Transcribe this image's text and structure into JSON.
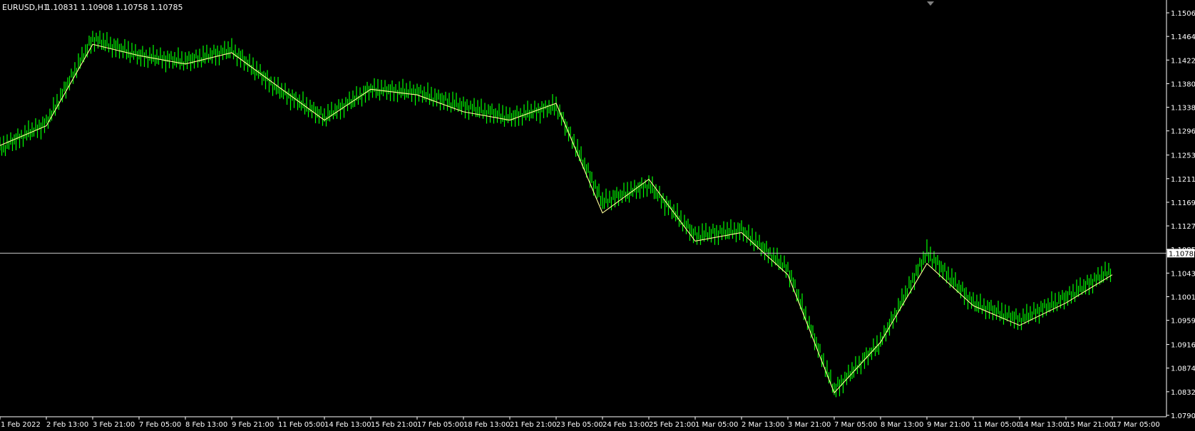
{
  "header": {
    "symbol": "EURUSD,H1",
    "ohlc": "1.10831 1.10908 1.10758 1.10785"
  },
  "chart_data": {
    "type": "line",
    "title": "EURUSD,H1  1.10831 1.10908 1.10758 1.10785",
    "xlabel": "",
    "ylabel": "",
    "ylim": [
      1.079,
      1.1506
    ],
    "grid": false,
    "legend": "none",
    "colors": {
      "background": "#000000",
      "bars": "#00ff00",
      "ma_line": "#ffff99",
      "price_line": "#c0c0c0",
      "axis": "#ffffff"
    },
    "y_ticks": [
      "1.15060",
      "1.14640",
      "1.14220",
      "1.13800",
      "1.13380",
      "1.12960",
      "1.12530",
      "1.12110",
      "1.11690",
      "1.11270",
      "1.10850",
      "1.10430",
      "1.10010",
      "1.09590",
      "1.09160",
      "1.08740",
      "1.08320",
      "1.07900"
    ],
    "x_ticks": [
      "1 Feb 2022",
      "2 Feb 13:00",
      "3 Feb 21:00",
      "7 Feb 05:00",
      "8 Feb 13:00",
      "9 Feb 21:00",
      "11 Feb 05:00",
      "14 Feb 13:00",
      "15 Feb 21:00",
      "17 Feb 05:00",
      "18 Feb 13:00",
      "21 Feb 21:00",
      "23 Feb 05:00",
      "24 Feb 13:00",
      "25 Feb 21:00",
      "1 Mar 05:00",
      "2 Mar 13:00",
      "3 Mar 21:00",
      "7 Mar 05:00",
      "8 Mar 13:00",
      "9 Mar 21:00",
      "11 Mar 05:00",
      "14 Mar 13:00",
      "15 Mar 21:00",
      "17 Mar 05:00"
    ],
    "current_price": "1.10785",
    "series": [
      {
        "name": "",
        "type": "bars",
        "x": [
          "1 Feb 2022",
          "2 Feb 13:00",
          "3 Feb 21:00",
          "7 Feb 05:00",
          "8 Feb 13:00",
          "9 Feb 21:00",
          "11 Feb 05:00",
          "14 Feb 13:00",
          "15 Feb 21:00",
          "17 Feb 05:00",
          "18 Feb 13:00",
          "21 Feb 21:00",
          "23 Feb 05:00",
          "24 Feb 13:00",
          "25 Feb 21:00",
          "1 Mar 05:00",
          "2 Mar 13:00",
          "3 Mar 21:00",
          "7 Mar 05:00",
          "8 Mar 13:00",
          "9 Mar 21:00",
          "11 Mar 05:00",
          "14 Mar 13:00",
          "15 Mar 21:00",
          "17 Mar 05:00"
        ],
        "values": [
          1.1265,
          1.131,
          1.146,
          1.143,
          1.142,
          1.144,
          1.137,
          1.132,
          1.137,
          1.1365,
          1.134,
          1.132,
          1.134,
          1.117,
          1.12,
          1.111,
          1.112,
          1.105,
          1.0835,
          1.092,
          1.108,
          1.099,
          1.096,
          1.1,
          1.105
        ]
      },
      {
        "name": "",
        "type": "moving_average",
        "x": [
          "1 Feb 2022",
          "2 Feb 13:00",
          "3 Feb 21:00",
          "7 Feb 05:00",
          "8 Feb 13:00",
          "9 Feb 21:00",
          "11 Feb 05:00",
          "14 Feb 13:00",
          "15 Feb 21:00",
          "17 Feb 05:00",
          "18 Feb 13:00",
          "21 Feb 21:00",
          "23 Feb 05:00",
          "24 Feb 13:00",
          "25 Feb 21:00",
          "1 Mar 05:00",
          "2 Mar 13:00",
          "3 Mar 21:00",
          "7 Mar 05:00",
          "8 Mar 13:00",
          "9 Mar 21:00",
          "11 Mar 05:00",
          "14 Mar 13:00",
          "15 Mar 21:00",
          "17 Mar 05:00"
        ],
        "values": [
          1.127,
          1.1305,
          1.145,
          1.143,
          1.1415,
          1.1435,
          1.1375,
          1.1315,
          1.137,
          1.136,
          1.133,
          1.1315,
          1.1345,
          1.115,
          1.121,
          1.11,
          1.1115,
          1.104,
          1.083,
          1.092,
          1.106,
          1.0985,
          1.095,
          1.099,
          1.104
        ]
      }
    ]
  }
}
